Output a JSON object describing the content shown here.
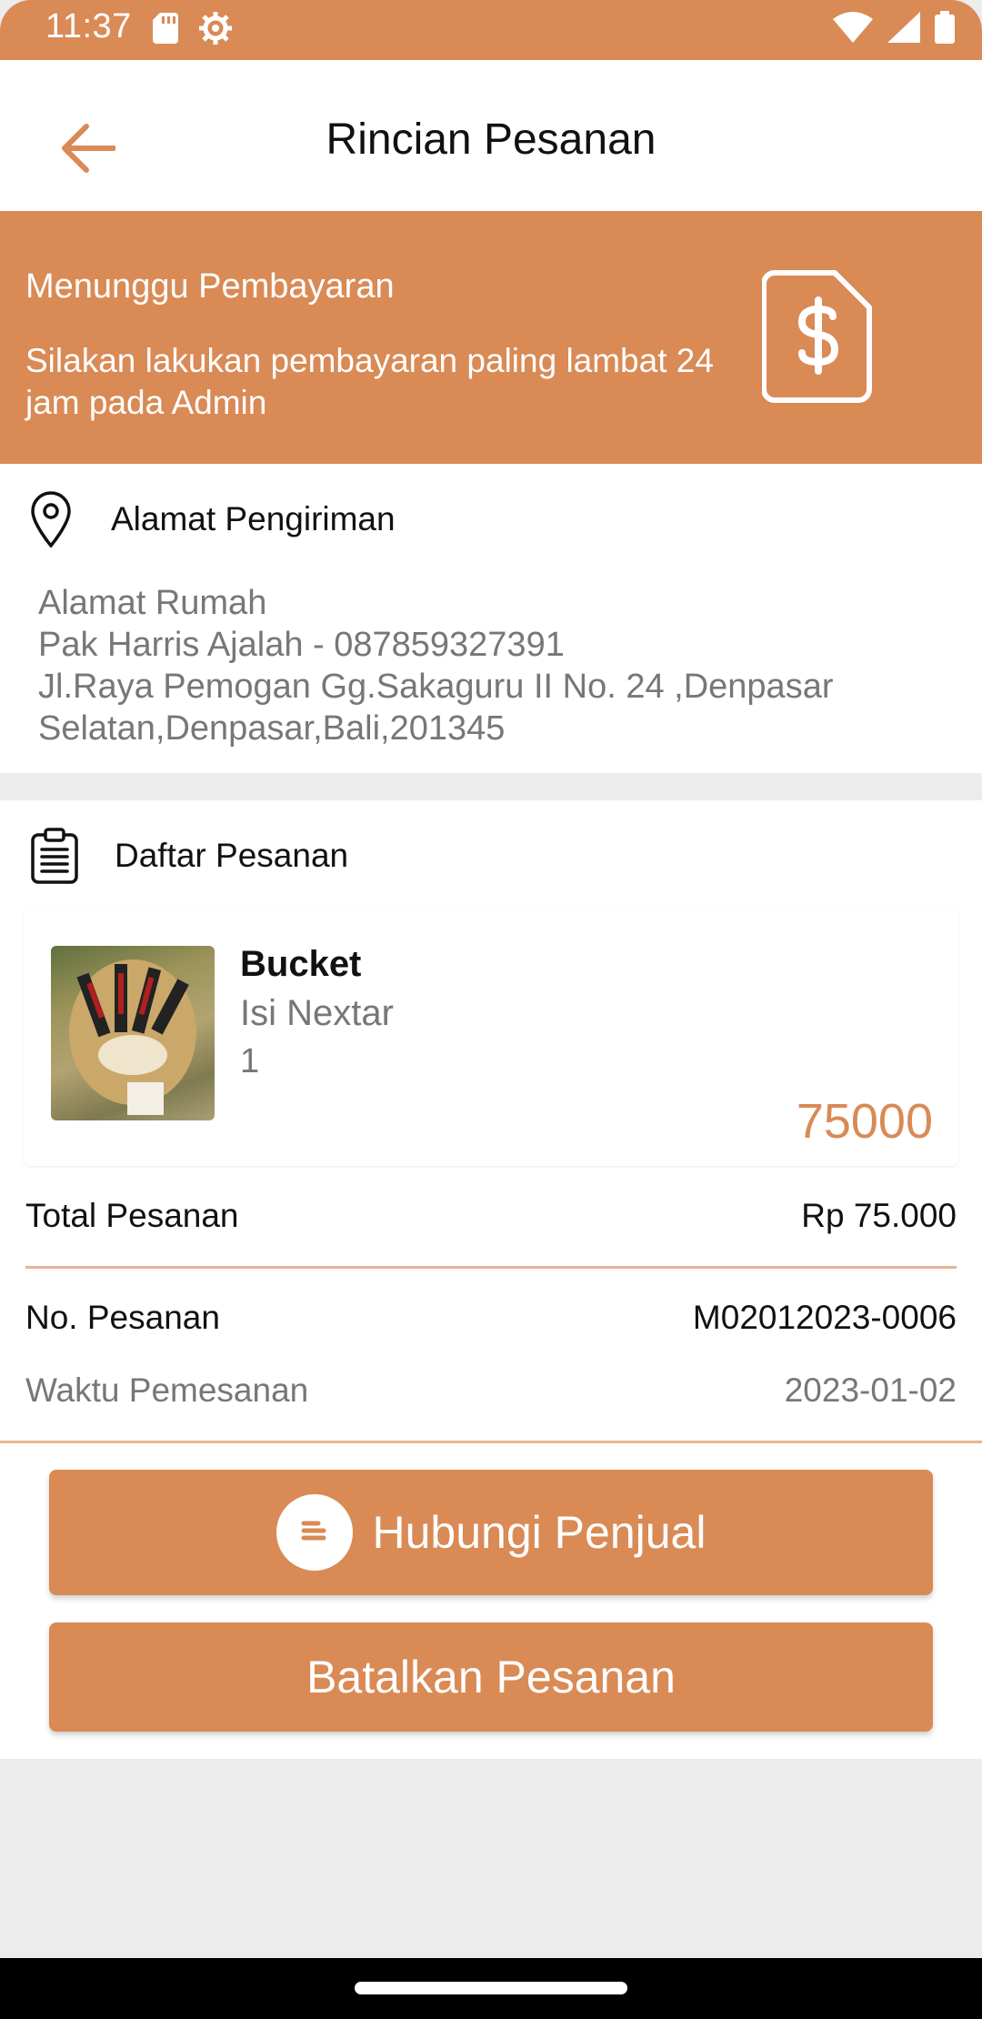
{
  "status_bar": {
    "time": "11:37",
    "icons_left": [
      "sd-card-icon",
      "settings-icon"
    ],
    "icons_right": [
      "wifi-icon",
      "signal-icon",
      "battery-icon"
    ],
    "color": "#d98a55"
  },
  "app_bar": {
    "title": "Rincian Pesanan",
    "back_icon": "arrow-left-icon"
  },
  "banner": {
    "title": "Menunggu Pembayaran",
    "description": "Silakan lakukan pembayaran paling lambat 24 jam pada Admin",
    "icon": "invoice-dollar-icon"
  },
  "address": {
    "heading": "Alamat Pengiriman",
    "icon": "location-pin-icon",
    "lines": [
      "Alamat Rumah",
      "Pak Harris Ajalah - 087859327391",
      "Jl.Raya Pemogan Gg.Sakaguru II No. 24 ,Denpasar Selatan,Denpasar,Bali,201345"
    ]
  },
  "orders": {
    "heading": "Daftar Pesanan",
    "icon": "clipboard-list-icon",
    "items": [
      {
        "name": "Bucket",
        "variant": "Isi Nextar",
        "qty": "1",
        "price": "75000"
      }
    ],
    "total_label": "Total Pesanan",
    "total_value": "Rp 75.000",
    "order_no_label": "No. Pesanan",
    "order_no_value": "M02012023-0006",
    "order_time_label": "Waktu Pemesanan",
    "order_time_value": "2023-01-02"
  },
  "actions": {
    "contact_label": "Hubungi Penjual",
    "cancel_label": "Batalkan Pesanan"
  },
  "colors": {
    "accent": "#d98a55",
    "accent_light": "#e9b592",
    "background": "#ececec"
  }
}
